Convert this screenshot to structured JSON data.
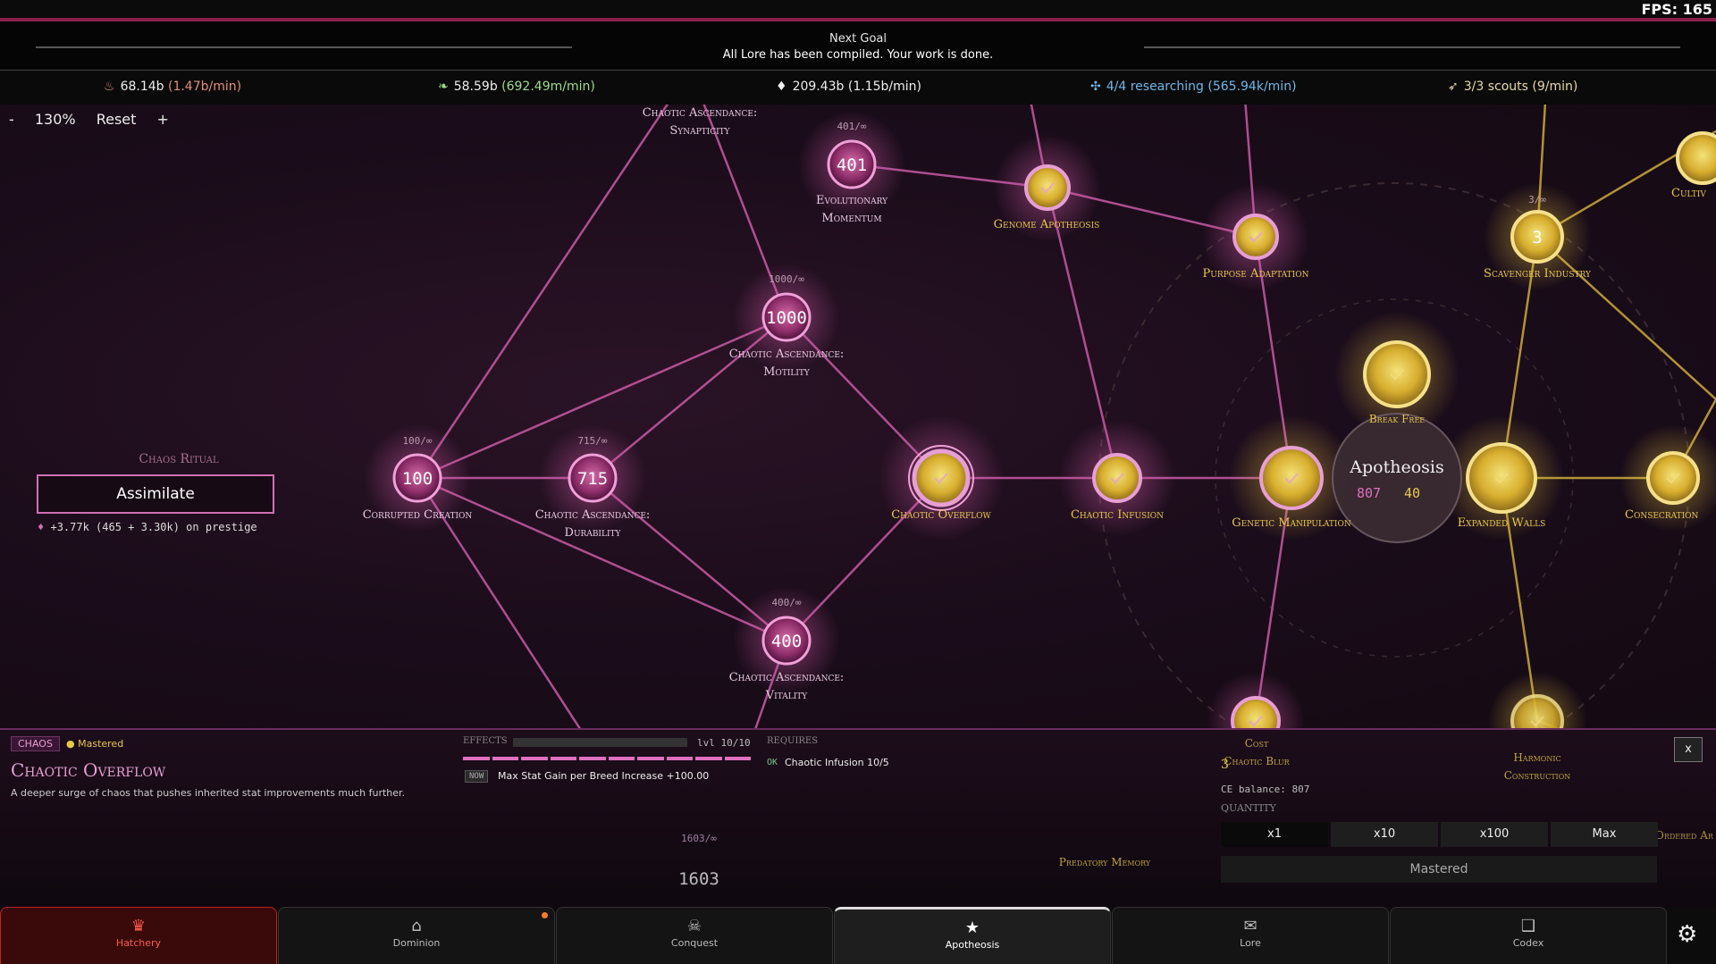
{
  "fps": "FPS: 165",
  "goal": {
    "title": "Next Goal",
    "text": "All Lore has been compiled. Your work is done."
  },
  "resources": [
    {
      "icon": "flame-icon",
      "value": "68.14b",
      "rate": "(1.47b/min)",
      "rate_color": "#e08e7a"
    },
    {
      "icon": "leaf-icon",
      "value": "58.59b",
      "rate": "(692.49m/min)",
      "rate_color": "#9fd98a"
    },
    {
      "icon": "drop-icon",
      "value": "209.43b",
      "rate": "(1.15b/min)",
      "rate_color": "#eeeeee"
    },
    {
      "icon": "research-icon",
      "value": "4/4 researching",
      "rate": "(565.94k/min)",
      "rate_color": "#6fb6e8"
    },
    {
      "icon": "scout-icon",
      "value": "3/3 scouts",
      "rate": "(9/min)",
      "rate_color": "#e7d8a8"
    }
  ],
  "zoom": {
    "minus": "-",
    "level": "130%",
    "reset": "Reset",
    "plus": "+"
  },
  "ritual": {
    "title": "Chaos Ritual",
    "button": "Assimilate",
    "prestige": "+3.77k (465 + 3.30k) on prestige"
  },
  "nodes": {
    "synapticity": {
      "label1": "Chaotic Ascendance:",
      "label2": "Synapticity"
    },
    "evolutionary": {
      "cap": "401/∞",
      "value": "401",
      "label1": "Evolutionary",
      "label2": "Momentum"
    },
    "genome": {
      "label": "Genome Apotheosis"
    },
    "purpose": {
      "label": "Purpose Adaptation"
    },
    "scavenger": {
      "cap": "3/∞",
      "value": "3",
      "label": "Scavenger Industry"
    },
    "cultiv": {
      "label": "Cultiv"
    },
    "motility": {
      "cap": "1000/∞",
      "value": "1000",
      "label1": "Chaotic Ascendance:",
      "label2": "Motility"
    },
    "breakfree": {
      "label": "Break Free"
    },
    "corrupted": {
      "cap": "100/∞",
      "value": "100",
      "label": "Corrupted Creation"
    },
    "durability": {
      "cap": "715/∞",
      "value": "715",
      "label1": "Chaotic Ascendance:",
      "label2": "Durability"
    },
    "overflow": {
      "label": "Chaotic Overflow"
    },
    "infusion": {
      "label": "Chaotic Infusion"
    },
    "genetic": {
      "label": "Genetic Manipulation"
    },
    "apotheosis": {
      "title": "Apotheosis",
      "v1": "807",
      "v2": "40"
    },
    "walls": {
      "label": "Expanded Walls"
    },
    "consecration": {
      "label": "Consecration"
    },
    "vitality": {
      "cap": "400/∞",
      "value": "400",
      "label1": "Chaotic Ascendance:",
      "label2": "Vitality"
    },
    "blur": {
      "label1": "Cost",
      "label2": "Chaotic Blur"
    },
    "harmonic": {
      "label1": "Harmonic",
      "label2": "Construction"
    },
    "predatory": {
      "label": "Predatory Memory"
    },
    "ordered": {
      "label": "Ordered Ar"
    },
    "bottom": {
      "cap": "1603/∞",
      "value": "1603"
    }
  },
  "panel": {
    "tag": "CHAOS",
    "status": "Mastered",
    "title": "Chaotic Overflow",
    "desc": "A deeper surge of chaos that pushes inherited stat improvements much further.",
    "effects_title": "EFFECTS",
    "level": "lvl 10/10",
    "now_tag": "NOW",
    "effect": "Max Stat Gain per Breed Increase +100.00",
    "requires_title": "REQUIRES",
    "ok_tag": "OK",
    "requirement": "Chaotic Infusion  10/5",
    "close": "x",
    "number": "3",
    "ce_balance": "CE balance: 807",
    "quantity": "QUANTITY",
    "qty_buttons": [
      "x1",
      "x10",
      "x100",
      "Max"
    ],
    "mastered_button": "Mastered"
  },
  "nav": [
    {
      "label": "Hatchery",
      "icon": "crown-icon"
    },
    {
      "label": "Dominion",
      "icon": "home-icon"
    },
    {
      "label": "Conquest",
      "icon": "skull-icon"
    },
    {
      "label": "Apotheosis",
      "icon": "star-icon"
    },
    {
      "label": "Lore",
      "icon": "scroll-icon"
    },
    {
      "label": "Codex",
      "icon": "book-icon"
    }
  ],
  "colors": {
    "pink": "#e070c0",
    "gold": "#e7c84a",
    "accent": "#8a1e4a"
  }
}
